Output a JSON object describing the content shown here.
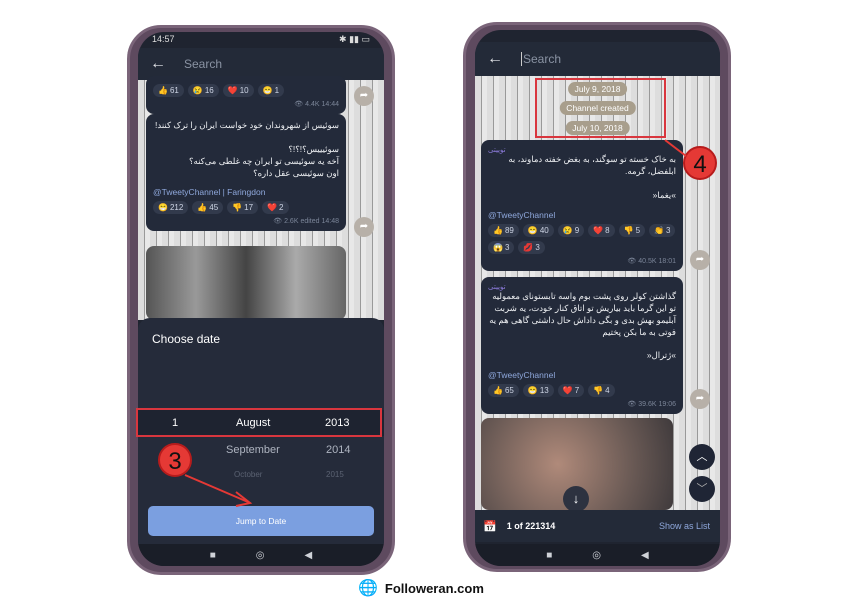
{
  "left_phone": {
    "status_time": "14:57",
    "search_placeholder": "Search",
    "msg1": {
      "reactions": [
        {
          "emoji": "👍",
          "count": "61"
        },
        {
          "emoji": "😢",
          "count": "16"
        },
        {
          "emoji": "❤️",
          "count": "10"
        },
        {
          "emoji": "😁",
          "count": "1"
        }
      ],
      "views": "4.4K",
      "time": "14:44"
    },
    "msg2": {
      "text": "سوئیس از شهروندان خود خواست ایران را ترک کنند!\n\nسوئیییس؟!؟!؟\nآخه یه سوئیسی تو ایران چه غلطی می‌کنه؟\nاون سوئیسی عقل داره؟",
      "signature": "@TweetyChannel | Faringdon",
      "reactions": [
        {
          "emoji": "😁",
          "count": "212"
        },
        {
          "emoji": "👍",
          "count": "45"
        },
        {
          "emoji": "👎",
          "count": "17"
        },
        {
          "emoji": "❤️",
          "count": "2"
        }
      ],
      "views": "2.6K",
      "time": "edited 14:48"
    },
    "sheet": {
      "title": "Choose date",
      "selected": {
        "day": "1",
        "month": "August",
        "year": "2013"
      },
      "next": {
        "month": "September",
        "year": "2014"
      },
      "next2": {
        "month": "October",
        "year": "2015"
      },
      "button": "Jump to Date"
    },
    "annotation": "3"
  },
  "right_phone": {
    "search_placeholder": "Search",
    "chips": [
      "July 9, 2018",
      "Channel created",
      "July 10, 2018"
    ],
    "annotation": "4",
    "msg1": {
      "author": "توییتی",
      "text": "به خاک خسته تو سوگند، به بغض خفته دماوند، به ابلفضل، گرمه.\n\n»یغما«",
      "signature": "@TweetyChannel",
      "reactions": [
        {
          "emoji": "👍",
          "count": "89"
        },
        {
          "emoji": "😁",
          "count": "40"
        },
        {
          "emoji": "😢",
          "count": "9"
        },
        {
          "emoji": "❤️",
          "count": "8"
        },
        {
          "emoji": "👎",
          "count": "5"
        },
        {
          "emoji": "👏",
          "count": "3"
        },
        {
          "emoji": "😱",
          "count": "3"
        },
        {
          "emoji": "💋",
          "count": "3"
        }
      ],
      "views": "40.5K",
      "time": "18:01"
    },
    "msg2": {
      "author": "توییتی",
      "text": "گذاشتن کولر روی پشت بوم واسه تابستونای معمولیه تو این گرما باید بیاریش تو اتاق کنار خودت، یه شربت آبلیمو بهش بدی و بگی داداش حال داشتی گاهی هم یه فوتی به ما بکن پختیم\n\n»ژترال«",
      "signature": "@TweetyChannel",
      "reactions": [
        {
          "emoji": "👍",
          "count": "65"
        },
        {
          "emoji": "😁",
          "count": "13"
        },
        {
          "emoji": "❤️",
          "count": "7"
        },
        {
          "emoji": "👎",
          "count": "4"
        }
      ],
      "views": "39.6K",
      "time": "19:06"
    },
    "bottom": {
      "counter": "1 of 221314",
      "show_list": "Show as List"
    }
  },
  "footer": {
    "brand": "Followeran.com"
  },
  "colors": {
    "accent": "#7b9fe0",
    "annotation": "#e53935",
    "bg": "#1f2430"
  }
}
